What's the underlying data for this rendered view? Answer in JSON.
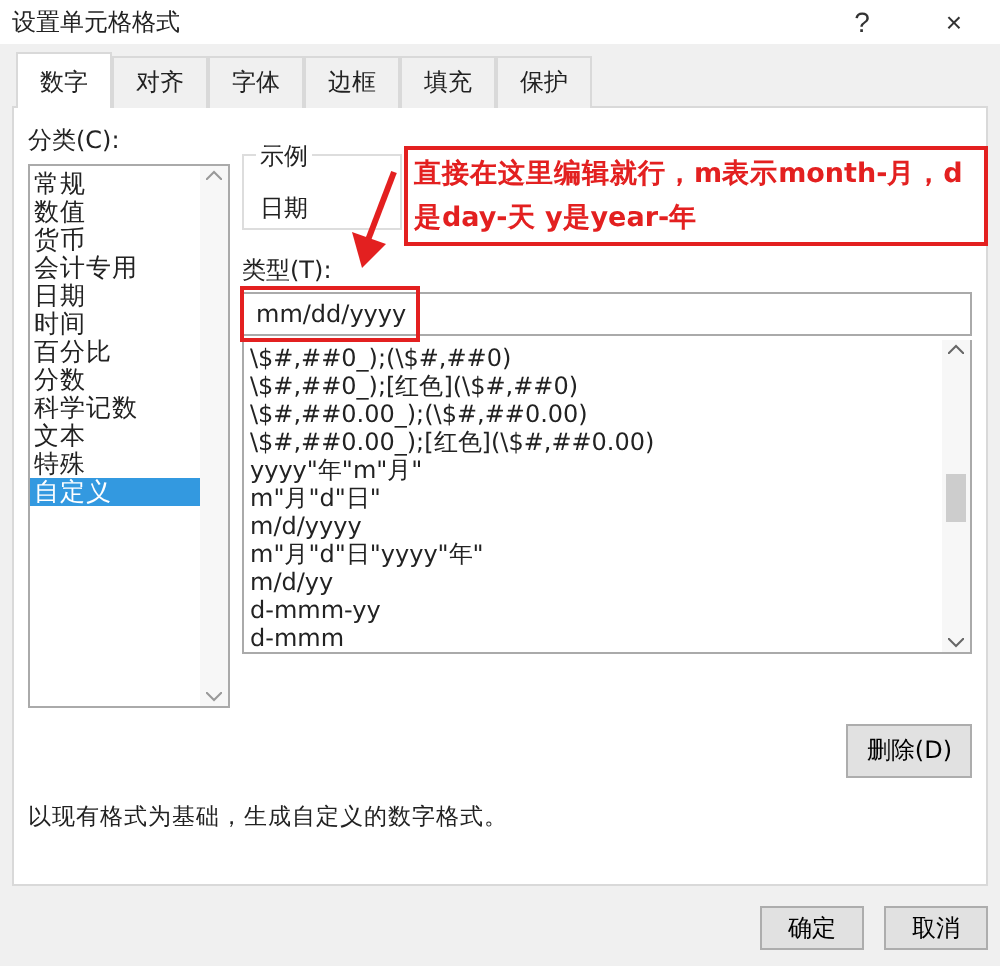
{
  "window": {
    "title": "设置单元格格式",
    "help": "?",
    "close": "×"
  },
  "tabs": [
    {
      "label": "数字",
      "selected": true
    },
    {
      "label": "对齐",
      "selected": false
    },
    {
      "label": "字体",
      "selected": false
    },
    {
      "label": "边框",
      "selected": false
    },
    {
      "label": "填充",
      "selected": false
    },
    {
      "label": "保护",
      "selected": false
    }
  ],
  "category": {
    "label": "分类(C):",
    "items": [
      {
        "label": "常规",
        "selected": false
      },
      {
        "label": "数值",
        "selected": false
      },
      {
        "label": "货币",
        "selected": false
      },
      {
        "label": "会计专用",
        "selected": false
      },
      {
        "label": "日期",
        "selected": false
      },
      {
        "label": "时间",
        "selected": false
      },
      {
        "label": "百分比",
        "selected": false
      },
      {
        "label": "分数",
        "selected": false
      },
      {
        "label": "科学记数",
        "selected": false
      },
      {
        "label": "文本",
        "selected": false
      },
      {
        "label": "特殊",
        "selected": false
      },
      {
        "label": "自定义",
        "selected": true
      }
    ]
  },
  "sample": {
    "label": "示例",
    "value": "日期"
  },
  "type": {
    "label": "类型(T):",
    "value": "mm/dd/yyyy"
  },
  "formats": [
    {
      "label": "\\$#,##0_);(\\$#,##0)",
      "selected": false
    },
    {
      "label": "\\$#,##0_);[红色](\\$#,##0)",
      "selected": false
    },
    {
      "label": "\\$#,##0.00_);(\\$#,##0.00)",
      "selected": false
    },
    {
      "label": "\\$#,##0.00_);[红色](\\$#,##0.00)",
      "selected": false
    },
    {
      "label": "yyyy\"年\"m\"月\"",
      "selected": false
    },
    {
      "label": "m\"月\"d\"日\"",
      "selected": false
    },
    {
      "label": "m/d/yyyy",
      "selected": false
    },
    {
      "label": "m\"月\"d\"日\"yyyy\"年\"",
      "selected": false
    },
    {
      "label": "m/d/yy",
      "selected": false
    },
    {
      "label": "d-mmm-yy",
      "selected": false
    },
    {
      "label": "d-mmm",
      "selected": false
    }
  ],
  "delete_button": "删除(D)",
  "description": "以现有格式为基础，生成自定义的数字格式。",
  "annotation": "直接在这里编辑就行，m表示month-月，d是day-天  y是year-年",
  "buttons": [
    "确定",
    "取消"
  ]
}
